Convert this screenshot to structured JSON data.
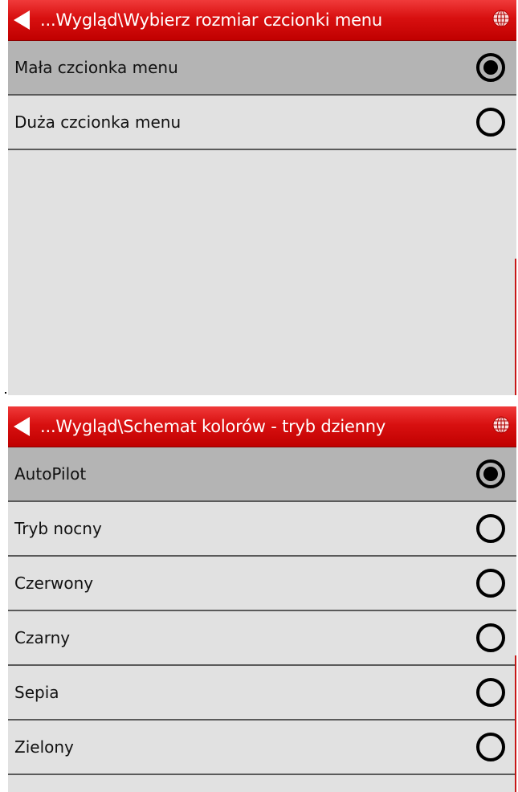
{
  "screen1": {
    "title": "...Wygląd\\Wybierz rozmiar czcionki menu",
    "options": [
      {
        "label": "Mała czcionka menu",
        "selected": true
      },
      {
        "label": "Duża czcionka menu",
        "selected": false
      }
    ]
  },
  "screen2": {
    "title": "...Wygląd\\Schemat kolorów - tryb dzienny",
    "options": [
      {
        "label": "AutoPilot",
        "selected": true
      },
      {
        "label": "Tryb nocny",
        "selected": false
      },
      {
        "label": "Czerwony",
        "selected": false
      },
      {
        "label": "Czarny",
        "selected": false
      },
      {
        "label": "Sepia",
        "selected": false
      },
      {
        "label": "Zielony",
        "selected": false
      }
    ]
  },
  "icons": {
    "back": "back-arrow-icon",
    "globe": "globe-icon"
  },
  "colors": {
    "titlebar": "#d81010",
    "selected_row": "#b4b4b4",
    "row": "#e1e1e1"
  }
}
